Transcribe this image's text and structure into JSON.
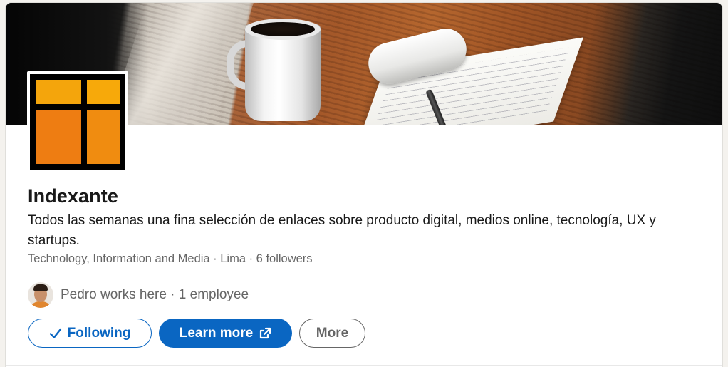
{
  "company": {
    "name": "Indexante",
    "tagline": "Todos las semanas una fina selección de enlaces sobre producto digital, medios online, tecnología, UX y startups.",
    "meta": "Technology, Information and Media · Lima · 6 followers",
    "employees_text": "Pedro works here · 1 employee",
    "logo_colors": [
      "#f4a50c",
      "#f7a90a",
      "#ee7d12",
      "#f08c10"
    ]
  },
  "actions": {
    "following_label": "Following",
    "learn_more_label": "Learn more",
    "more_label": "More"
  },
  "icons": {
    "following": "checkmark-icon",
    "learn_more": "external-link-icon"
  },
  "colors": {
    "accent": "#0a66c2",
    "text": "#191919",
    "muted": "#666666"
  }
}
